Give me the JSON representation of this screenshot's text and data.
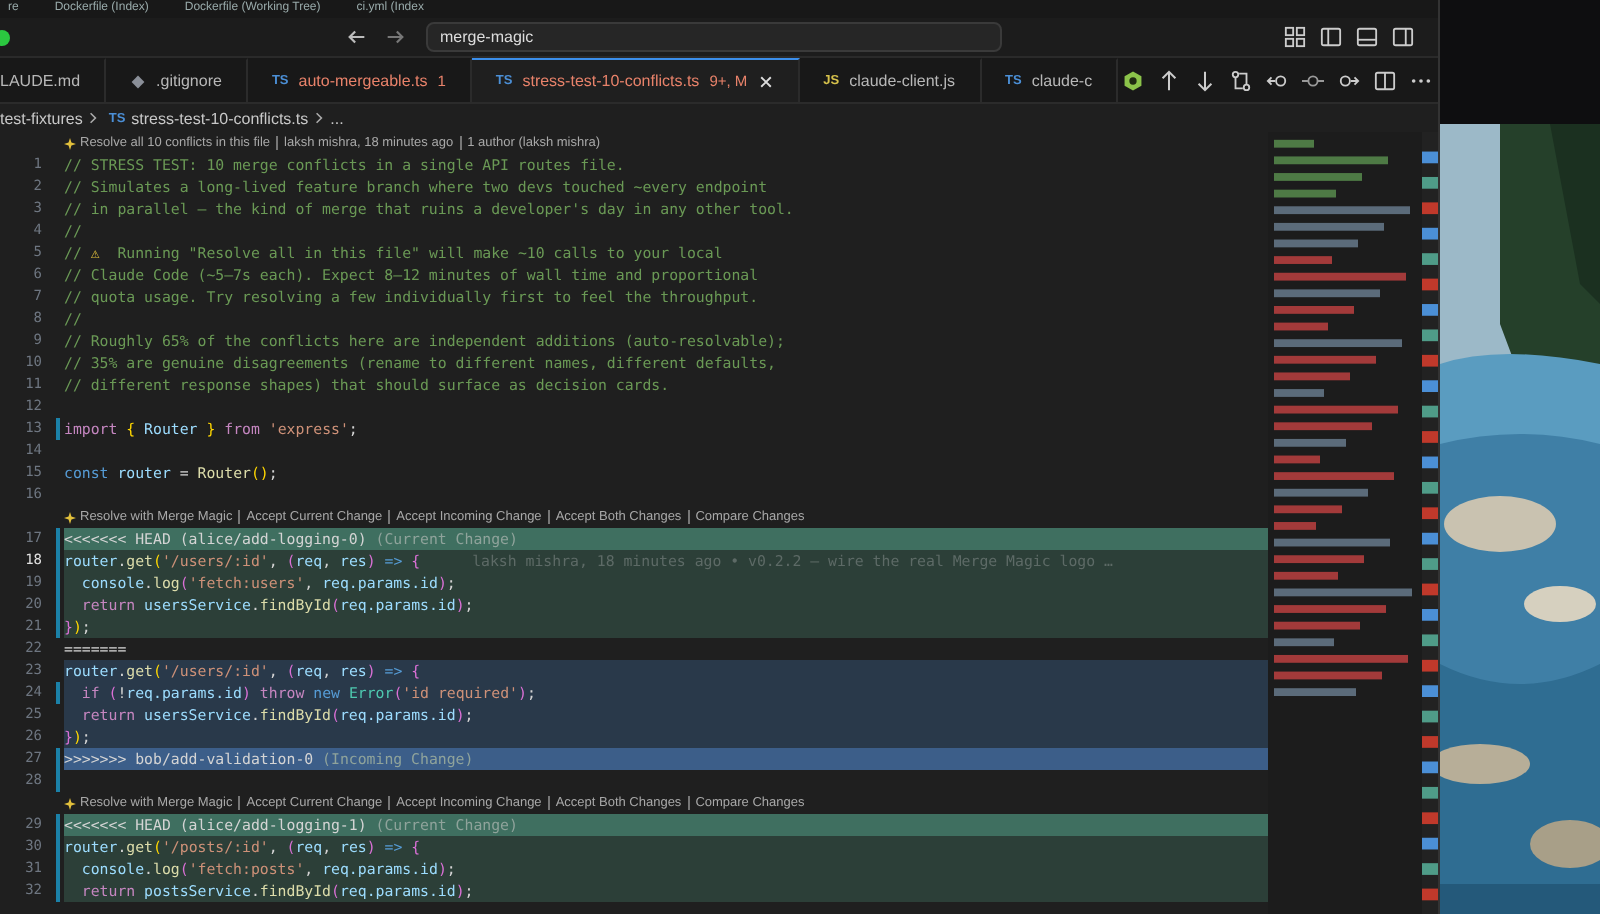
{
  "back_window_tabs": [
    {
      "label": "re"
    },
    {
      "label": "Dockerfile (Index)"
    },
    {
      "label": "Dockerfile (Working Tree)"
    },
    {
      "label": "ci.yml (Index"
    }
  ],
  "title_bar": {
    "search": "merge-magic"
  },
  "tabs": [
    {
      "label": "LAUDE.md",
      "kind": "plain",
      "selected": false,
      "error": false
    },
    {
      "label": ".gitignore",
      "kind": "git",
      "selected": false,
      "error": false
    },
    {
      "label": "auto-mergeable.ts",
      "kind": "ts",
      "icon_text": "TS",
      "badge": "1",
      "selected": false,
      "error": true
    },
    {
      "label": "stress-test-10-conflicts.ts",
      "kind": "ts",
      "icon_text": "TS",
      "badge": "9+, M",
      "selected": true,
      "error": true
    },
    {
      "label": "claude-client.js",
      "kind": "js",
      "icon_text": "JS",
      "selected": false,
      "error": false
    },
    {
      "label": "claude-c",
      "kind": "ts",
      "icon_text": "TS",
      "selected": false,
      "error": false
    }
  ],
  "breadcrumb": [
    {
      "label": "test-fixtures"
    },
    {
      "label": "stress-test-10-conflicts.ts",
      "icon_text": "TS"
    },
    {
      "label": "..."
    }
  ],
  "code": [
    {
      "kind": "codelens",
      "items": [
        "Resolve all 10 conflicts in this file",
        "laksh mishra, 18 minutes ago",
        "1 author (laksh mishra)"
      ]
    },
    {
      "kind": "line",
      "number": "1",
      "active": false,
      "changed": false,
      "tokens": [
        {
          "t": "// STRESS TEST: 10 merge conflicts in a single API routes file.",
          "kind": "comment"
        }
      ]
    },
    {
      "kind": "line",
      "number": "2",
      "active": false,
      "changed": false,
      "tokens": [
        {
          "t": "// Simulates a long-lived feature branch where two devs touched ~every endpoint",
          "kind": "comment"
        }
      ]
    },
    {
      "kind": "line",
      "number": "3",
      "active": false,
      "changed": false,
      "tokens": [
        {
          "t": "// in parallel — the kind of merge that ruins a developer's day in any other tool.",
          "kind": "comment"
        }
      ]
    },
    {
      "kind": "line",
      "number": "4",
      "active": false,
      "changed": false,
      "tokens": [
        {
          "t": "//",
          "kind": "comment"
        }
      ]
    },
    {
      "kind": "line",
      "number": "5",
      "active": false,
      "changed": false,
      "tokens": [
        {
          "t": "// ",
          "kind": "comment"
        },
        {
          "t": "⚠",
          "kind": "warning"
        },
        {
          "t": "  Running \"Resolve all in this file\" will make ~10 calls to your local",
          "kind": "comment"
        }
      ]
    },
    {
      "kind": "line",
      "number": "6",
      "active": false,
      "changed": false,
      "tokens": [
        {
          "t": "// Claude Code (~5–7s each). Expect 8–12 minutes of wall time and proportional",
          "kind": "comment"
        }
      ]
    },
    {
      "kind": "line",
      "number": "7",
      "active": false,
      "changed": false,
      "tokens": [
        {
          "t": "// quota usage. Try resolving a few individually first to feel the throughput.",
          "kind": "comment"
        }
      ]
    },
    {
      "kind": "line",
      "number": "8",
      "active": false,
      "changed": false,
      "tokens": [
        {
          "t": "//",
          "kind": "comment"
        }
      ]
    },
    {
      "kind": "line",
      "number": "9",
      "active": false,
      "changed": false,
      "tokens": [
        {
          "t": "// Roughly 65% of the conflicts here are independent additions (auto-resolvable);",
          "kind": "comment"
        }
      ]
    },
    {
      "kind": "line",
      "number": "10",
      "active": false,
      "changed": false,
      "tokens": [
        {
          "t": "// 35% are genuine disagreements (rename to different names, different defaults,",
          "kind": "comment"
        }
      ]
    },
    {
      "kind": "line",
      "number": "11",
      "active": false,
      "changed": false,
      "tokens": [
        {
          "t": "// different response shapes) that should surface as decision cards.",
          "kind": "comment"
        }
      ]
    },
    {
      "kind": "line",
      "number": "12",
      "active": false,
      "changed": false
    },
    {
      "kind": "line",
      "number": "13",
      "active": false,
      "changed": true,
      "tokens": [
        {
          "t": "import ",
          "kind": "keyword"
        },
        {
          "t": "{",
          "kind": "brace"
        },
        {
          "t": " Router ",
          "kind": "variable"
        },
        {
          "t": "}",
          "kind": "brace"
        },
        {
          "t": " from ",
          "kind": "keyword"
        },
        {
          "t": "'express'",
          "kind": "string"
        },
        {
          "t": ";",
          "kind": "plain"
        }
      ]
    },
    {
      "kind": "line",
      "number": "14",
      "active": false,
      "changed": false
    },
    {
      "kind": "line",
      "number": "15",
      "active": false,
      "changed": false,
      "tokens": [
        {
          "t": "const ",
          "kind": "storage"
        },
        {
          "t": "router",
          "kind": "variable"
        },
        {
          "t": " = ",
          "kind": "plain"
        },
        {
          "t": "Router",
          "kind": "function"
        },
        {
          "t": "()",
          "kind": "brace"
        },
        {
          "t": ";",
          "kind": "plain"
        }
      ]
    },
    {
      "kind": "line",
      "number": "16",
      "active": false,
      "changed": false
    },
    {
      "kind": "codelens",
      "items": [
        "Resolve with Merge Magic",
        "Accept Current Change",
        "Accept Incoming Change",
        "Accept Both Changes",
        "Compare Changes"
      ]
    },
    {
      "kind": "current-marker",
      "number": "17",
      "active": false,
      "changed": true,
      "tokens": [
        {
          "t": "<<<<<<< HEAD (alice/add-logging-0)",
          "kind": "plain"
        },
        {
          "t": " (Current Change)",
          "kind": "muted"
        }
      ]
    },
    {
      "kind": "current",
      "number": "18",
      "active": true,
      "changed": true,
      "blame": "laksh mishra, 18 minutes ago • v0.2.2 — wire the real Merge Magic logo …",
      "tokens": [
        {
          "t": "router",
          "kind": "variable"
        },
        {
          "t": ".",
          "kind": "plain"
        },
        {
          "t": "get",
          "kind": "function"
        },
        {
          "t": "(",
          "kind": "brace"
        },
        {
          "t": "'/users/:id'",
          "kind": "string"
        },
        {
          "t": ", ",
          "kind": "plain"
        },
        {
          "t": "(",
          "kind": "paren"
        },
        {
          "t": "req",
          "kind": "variable"
        },
        {
          "t": ", ",
          "kind": "plain"
        },
        {
          "t": "res",
          "kind": "variable"
        },
        {
          "t": ")",
          "kind": "paren"
        },
        {
          "t": " => ",
          "kind": "storage"
        },
        {
          "t": "{",
          "kind": "paren"
        }
      ]
    },
    {
      "kind": "current",
      "number": "19",
      "active": false,
      "changed": true,
      "tokens": [
        {
          "t": "  console",
          "kind": "variable"
        },
        {
          "t": ".",
          "kind": "plain"
        },
        {
          "t": "log",
          "kind": "function"
        },
        {
          "t": "(",
          "kind": "paren"
        },
        {
          "t": "'fetch:users'",
          "kind": "string"
        },
        {
          "t": ", ",
          "kind": "plain"
        },
        {
          "t": "req.params.id",
          "kind": "variable"
        },
        {
          "t": ")",
          "kind": "paren"
        },
        {
          "t": ";",
          "kind": "plain"
        }
      ]
    },
    {
      "kind": "current",
      "number": "20",
      "active": false,
      "changed": true,
      "tokens": [
        {
          "t": "  return ",
          "kind": "keyword"
        },
        {
          "t": "usersService",
          "kind": "variable"
        },
        {
          "t": ".",
          "kind": "plain"
        },
        {
          "t": "findById",
          "kind": "function"
        },
        {
          "t": "(",
          "kind": "paren"
        },
        {
          "t": "req.params.id",
          "kind": "variable"
        },
        {
          "t": ")",
          "kind": "paren"
        },
        {
          "t": ";",
          "kind": "plain"
        }
      ]
    },
    {
      "kind": "current",
      "number": "21",
      "active": false,
      "changed": true,
      "tokens": [
        {
          "t": "}",
          "kind": "paren"
        },
        {
          "t": ")",
          "kind": "brace"
        },
        {
          "t": ";",
          "kind": "plain"
        }
      ]
    },
    {
      "kind": "line",
      "number": "22",
      "active": false,
      "changed": false,
      "tokens": [
        {
          "t": "=======",
          "kind": "plain"
        }
      ]
    },
    {
      "kind": "incoming",
      "number": "23",
      "active": false,
      "changed": false,
      "tokens": [
        {
          "t": "router",
          "kind": "variable"
        },
        {
          "t": ".",
          "kind": "plain"
        },
        {
          "t": "get",
          "kind": "function"
        },
        {
          "t": "(",
          "kind": "brace"
        },
        {
          "t": "'/users/:id'",
          "kind": "string"
        },
        {
          "t": ", ",
          "kind": "plain"
        },
        {
          "t": "(",
          "kind": "paren"
        },
        {
          "t": "req",
          "kind": "variable"
        },
        {
          "t": ", ",
          "kind": "plain"
        },
        {
          "t": "res",
          "kind": "variable"
        },
        {
          "t": ")",
          "kind": "paren"
        },
        {
          "t": " => ",
          "kind": "storage"
        },
        {
          "t": "{",
          "kind": "paren"
        }
      ]
    },
    {
      "kind": "incoming",
      "number": "24",
      "active": false,
      "changed": true,
      "tokens": [
        {
          "t": "  if ",
          "kind": "keyword"
        },
        {
          "t": "(",
          "kind": "paren"
        },
        {
          "t": "!",
          "kind": "plain"
        },
        {
          "t": "req.params.id",
          "kind": "variable"
        },
        {
          "t": ")",
          "kind": "paren"
        },
        {
          "t": " throw ",
          "kind": "keyword"
        },
        {
          "t": "new ",
          "kind": "storage"
        },
        {
          "t": "Error",
          "kind": "type"
        },
        {
          "t": "(",
          "kind": "paren"
        },
        {
          "t": "'id required'",
          "kind": "string"
        },
        {
          "t": ")",
          "kind": "paren"
        },
        {
          "t": ";",
          "kind": "plain"
        }
      ]
    },
    {
      "kind": "incoming",
      "number": "25",
      "active": false,
      "changed": false,
      "tokens": [
        {
          "t": "  return ",
          "kind": "keyword"
        },
        {
          "t": "usersService",
          "kind": "variable"
        },
        {
          "t": ".",
          "kind": "plain"
        },
        {
          "t": "findById",
          "kind": "function"
        },
        {
          "t": "(",
          "kind": "paren"
        },
        {
          "t": "req.params.id",
          "kind": "variable"
        },
        {
          "t": ")",
          "kind": "paren"
        },
        {
          "t": ";",
          "kind": "plain"
        }
      ]
    },
    {
      "kind": "incoming",
      "number": "26",
      "active": false,
      "changed": false,
      "tokens": [
        {
          "t": "}",
          "kind": "paren"
        },
        {
          "t": ")",
          "kind": "brace"
        },
        {
          "t": ";",
          "kind": "plain"
        }
      ]
    },
    {
      "kind": "incoming-marker",
      "number": "27",
      "active": false,
      "changed": true,
      "tokens": [
        {
          "t": ">>>>>>> bob/add-validation-0",
          "kind": "plain"
        },
        {
          "t": " (Incoming Change)",
          "kind": "muted"
        }
      ]
    },
    {
      "kind": "line",
      "number": "28",
      "active": false,
      "changed": true
    },
    {
      "kind": "codelens",
      "items": [
        "Resolve with Merge Magic",
        "Accept Current Change",
        "Accept Incoming Change",
        "Accept Both Changes",
        "Compare Changes"
      ]
    },
    {
      "kind": "current-marker",
      "number": "29",
      "active": false,
      "changed": true,
      "tokens": [
        {
          "t": "<<<<<<< HEAD (alice/add-logging-1)",
          "kind": "plain"
        },
        {
          "t": " (Current Change)",
          "kind": "muted"
        }
      ]
    },
    {
      "kind": "current",
      "number": "30",
      "active": false,
      "changed": true,
      "tokens": [
        {
          "t": "router",
          "kind": "variable"
        },
        {
          "t": ".",
          "kind": "plain"
        },
        {
          "t": "get",
          "kind": "function"
        },
        {
          "t": "(",
          "kind": "brace"
        },
        {
          "t": "'/posts/:id'",
          "kind": "string"
        },
        {
          "t": ", ",
          "kind": "plain"
        },
        {
          "t": "(",
          "kind": "paren"
        },
        {
          "t": "req",
          "kind": "variable"
        },
        {
          "t": ", ",
          "kind": "plain"
        },
        {
          "t": "res",
          "kind": "variable"
        },
        {
          "t": ")",
          "kind": "paren"
        },
        {
          "t": " => ",
          "kind": "storage"
        },
        {
          "t": "{",
          "kind": "paren"
        }
      ]
    },
    {
      "kind": "current",
      "number": "31",
      "active": false,
      "changed": true,
      "tokens": [
        {
          "t": "  console",
          "kind": "variable"
        },
        {
          "t": ".",
          "kind": "plain"
        },
        {
          "t": "log",
          "kind": "function"
        },
        {
          "t": "(",
          "kind": "paren"
        },
        {
          "t": "'fetch:posts'",
          "kind": "string"
        },
        {
          "t": ", ",
          "kind": "plain"
        },
        {
          "t": "req.params.id",
          "kind": "variable"
        },
        {
          "t": ")",
          "kind": "paren"
        },
        {
          "t": ";",
          "kind": "plain"
        }
      ]
    },
    {
      "kind": "current",
      "number": "32",
      "active": false,
      "changed": true,
      "tokens": [
        {
          "t": "  return ",
          "kind": "keyword"
        },
        {
          "t": "postsService",
          "kind": "variable"
        },
        {
          "t": ".",
          "kind": "plain"
        },
        {
          "t": "findById",
          "kind": "function"
        },
        {
          "t": "(",
          "kind": "paren"
        },
        {
          "t": "req.params.id",
          "kind": "variable"
        },
        {
          "t": ")",
          "kind": "paren"
        },
        {
          "t": ";",
          "kind": "plain"
        }
      ]
    }
  ]
}
